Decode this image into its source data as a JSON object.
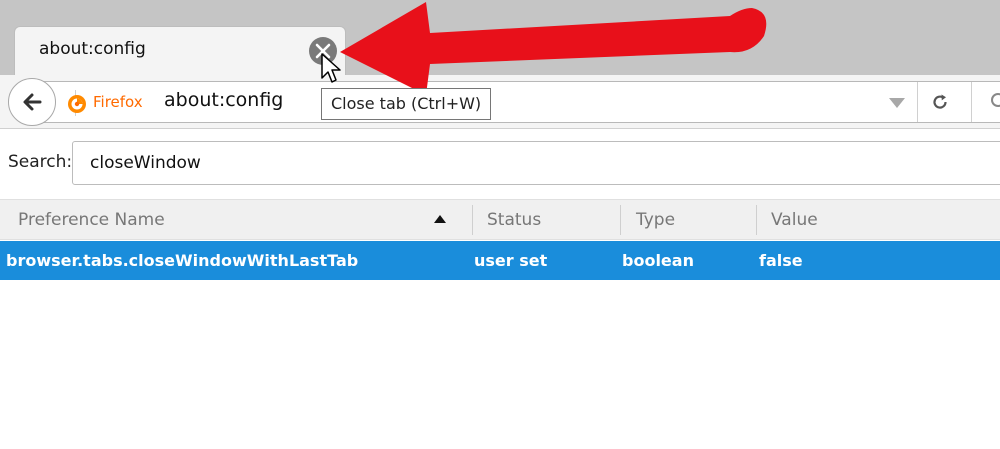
{
  "tab": {
    "title": "about:config",
    "close_tooltip": "Close tab (Ctrl+W)"
  },
  "navbar": {
    "identity_label": "Firefox",
    "url": "about:config"
  },
  "search": {
    "label": "Search:",
    "value": "closeWindow"
  },
  "table": {
    "headers": [
      "Preference Name",
      "Status",
      "Type",
      "Value"
    ],
    "sort_column": "Preference Name",
    "rows": [
      {
        "name": "browser.tabs.closeWindowWithLastTab",
        "status": "user set",
        "type": "boolean",
        "value": "false",
        "selected": true
      }
    ]
  },
  "colors": {
    "selection": "#1a8ddb",
    "annotation_arrow": "#e8101a",
    "firefox_brand": "#ff6a00"
  }
}
